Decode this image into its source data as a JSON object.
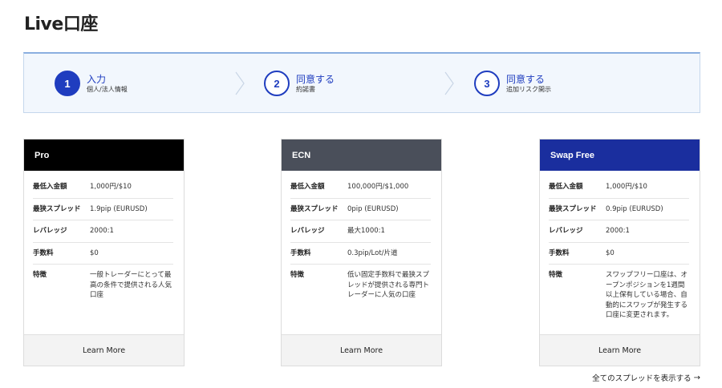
{
  "page": {
    "title": "Live口座"
  },
  "steps": [
    {
      "number": "1",
      "title": "入力",
      "subtitle": "個人/法人情報",
      "state": "active"
    },
    {
      "number": "2",
      "title": "同意する",
      "subtitle": "約諾書",
      "state": "inactive"
    },
    {
      "number": "3",
      "title": "同意する",
      "subtitle": "追加リスク開示",
      "state": "inactive"
    }
  ],
  "colors": {
    "accent": "#1f3dbf",
    "pro_header": "#000000",
    "ecn_header": "#4a4f5a",
    "swap_header": "#1a2e9e"
  },
  "cards": [
    {
      "name": "Pro",
      "rows": [
        {
          "label": "最低入金額",
          "value": "1,000円/$10"
        },
        {
          "label": "最狭スプレッド",
          "value": "1.9pip (EURUSD)"
        },
        {
          "label": "レバレッジ",
          "value": "2000:1"
        },
        {
          "label": "手数料",
          "value": "$0"
        },
        {
          "label": "特徴",
          "value": "一般トレーダーにとって最高の条件で提供される人気口座"
        }
      ],
      "footer": "Learn More"
    },
    {
      "name": "ECN",
      "rows": [
        {
          "label": "最低入金額",
          "value": "100,000円/$1,000"
        },
        {
          "label": "最狭スプレッド",
          "value": "0pip (EURUSD)"
        },
        {
          "label": "レバレッジ",
          "value": "最大1000:1"
        },
        {
          "label": "手数料",
          "value": "0.3pip/Lot/片道"
        },
        {
          "label": "特徴",
          "value": "低い固定手数料で最狭スプレッドが提供される専門トレーダーに人気の口座"
        }
      ],
      "footer": "Learn More"
    },
    {
      "name": "Swap Free",
      "rows": [
        {
          "label": "最低入金額",
          "value": "1,000円/$10"
        },
        {
          "label": "最狭スプレッド",
          "value": "0.9pip (EURUSD)"
        },
        {
          "label": "レバレッジ",
          "value": "2000:1"
        },
        {
          "label": "手数料",
          "value": "$0"
        },
        {
          "label": "特徴",
          "value": "スワップフリー口座は、オープンポジションを1週間以上保有している場合、自動的にスワップが発生する口座に変更されます。"
        }
      ],
      "footer": "Learn More"
    }
  ],
  "links": {
    "all_spreads": "全てのスプレッドを表示する",
    "arrow_icon": "arrow-right-icon"
  }
}
